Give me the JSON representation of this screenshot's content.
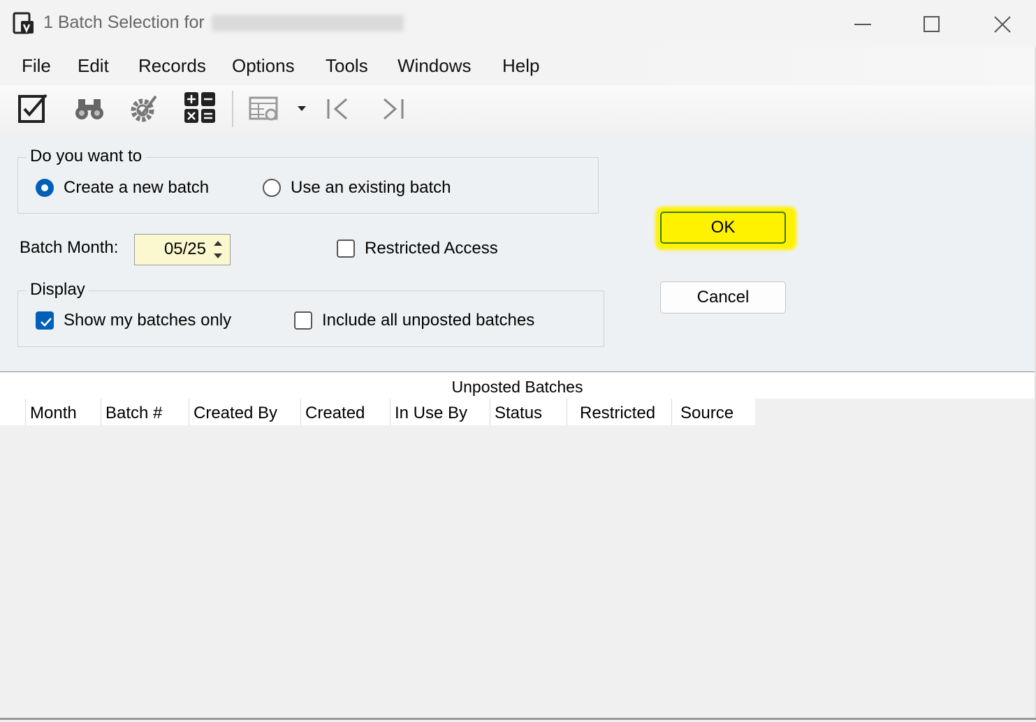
{
  "window": {
    "title": "1 Batch Selection for",
    "icons": {
      "app": "app-form-icon",
      "minimize": "minimize-icon",
      "maximize": "maximize-icon",
      "close": "close-icon"
    }
  },
  "menu": [
    "File",
    "Edit",
    "Records",
    "Options",
    "Tools",
    "Windows",
    "Help"
  ],
  "toolbar": {
    "icons": [
      "edit-check-icon",
      "binoculars-find-icon",
      "gear-settings-icon",
      "calculator-icon",
      "grid-settings-icon",
      "dropdown-arrow-icon",
      "first-record-icon",
      "last-record-icon"
    ]
  },
  "batch_options": {
    "legend": "Do you want to",
    "create_new": "Create a new batch",
    "use_existing": "Use an existing batch",
    "selected": "create_new"
  },
  "batch_month": {
    "label": "Batch Month:",
    "value": "05/25"
  },
  "restricted_access": {
    "label": "Restricted Access",
    "checked": false
  },
  "display": {
    "legend": "Display",
    "show_mine": "Show my batches only",
    "show_mine_checked": true,
    "include_unposted": "Include all unposted batches",
    "include_unposted_checked": false
  },
  "buttons": {
    "ok": "OK",
    "cancel": "Cancel",
    "ok_highlight_color": "#fff200"
  },
  "unposted_batches": {
    "title": "Unposted Batches",
    "columns": [
      "Month",
      "Batch #",
      "Created By",
      "Created",
      "In Use By",
      "Status",
      "Restricted",
      "Source"
    ],
    "rows": []
  }
}
